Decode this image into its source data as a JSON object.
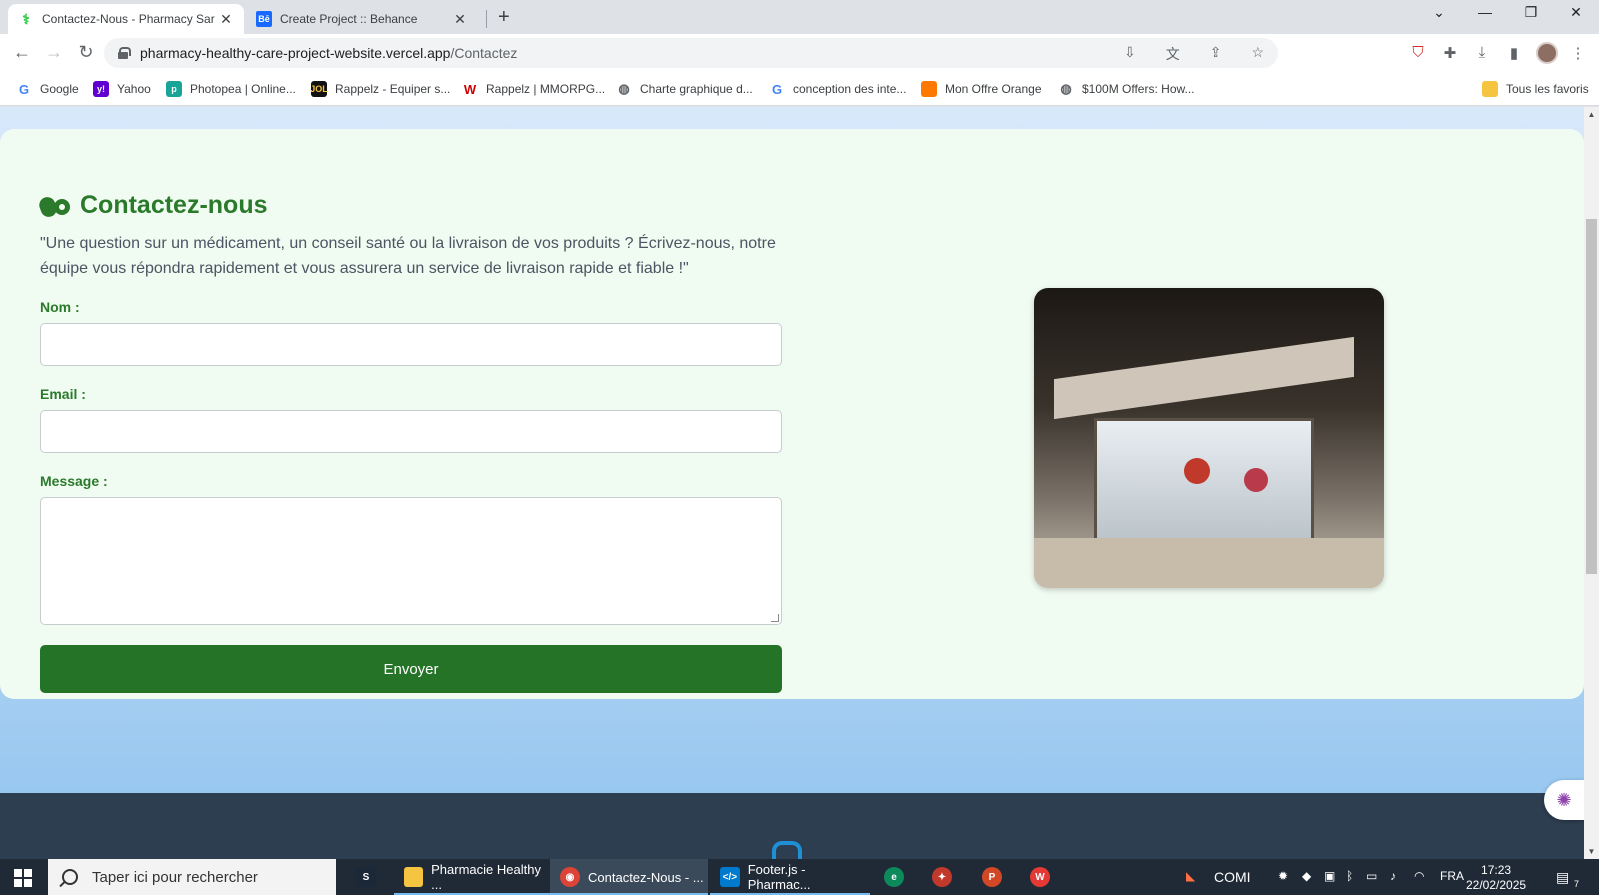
{
  "browser": {
    "tabs": [
      {
        "title": "Contactez-Nous - Pharmacy Sar",
        "active": true
      },
      {
        "title": "Create Project :: Behance",
        "active": false
      }
    ],
    "url_host": "pharmacy-healthy-care-project-website.vercel.app",
    "url_path": "/Contactez",
    "bookmarks": [
      {
        "label": "Google",
        "icon": "google-icon",
        "color": "#4285f4"
      },
      {
        "label": "Yahoo",
        "icon": "yahoo-icon",
        "color": "#6001d2"
      },
      {
        "label": "Photopea | Online...",
        "icon": "photopea-icon",
        "color": "#18a497"
      },
      {
        "label": "Rappelz - Equiper s...",
        "icon": "rappelz-icon",
        "color": "#111111"
      },
      {
        "label": "Rappelz | MMORPG...",
        "icon": "webzen-icon",
        "color": "#cc0000"
      },
      {
        "label": "Charte graphique d...",
        "icon": "globe-icon",
        "color": "#5f6368"
      },
      {
        "label": "conception des inte...",
        "icon": "google-icon",
        "color": "#4285f4"
      },
      {
        "label": "Mon Offre Orange",
        "icon": "orange-icon",
        "color": "#ff7900"
      },
      {
        "label": "$100M Offers: How...",
        "icon": "globe-icon",
        "color": "#5f6368"
      }
    ],
    "all_bookmarks_label": "Tous les favoris"
  },
  "contact": {
    "title": "Contactez-nous",
    "description": "\"Une question sur un médicament, un conseil santé ou la livraison de vos produits ? Écrivez-nous, notre équipe vous répondra rapidement et vous assurera un service de livraison rapide et fiable !\"",
    "name_label": "Nom :",
    "name_value": "",
    "email_label": "Email :",
    "email_value": "",
    "message_label": "Message :",
    "message_value": "",
    "submit_label": "Envoyer",
    "accent_color": "#247326",
    "photo": "pharmacy-storefront-photo"
  },
  "taskbar": {
    "search_placeholder": "Taper ici pour rechercher",
    "items": [
      {
        "label": "Pharmacie Healthy ...",
        "icon": "folder-icon"
      },
      {
        "label": "Contactez-Nous - ...",
        "icon": "chrome-icon"
      },
      {
        "label": "Footer.js - Pharmac...",
        "icon": "vscode-icon"
      }
    ],
    "tray_app": "COMI",
    "language": "FRA",
    "time": "17:23",
    "date": "22/02/2025",
    "notification_count": "7"
  }
}
